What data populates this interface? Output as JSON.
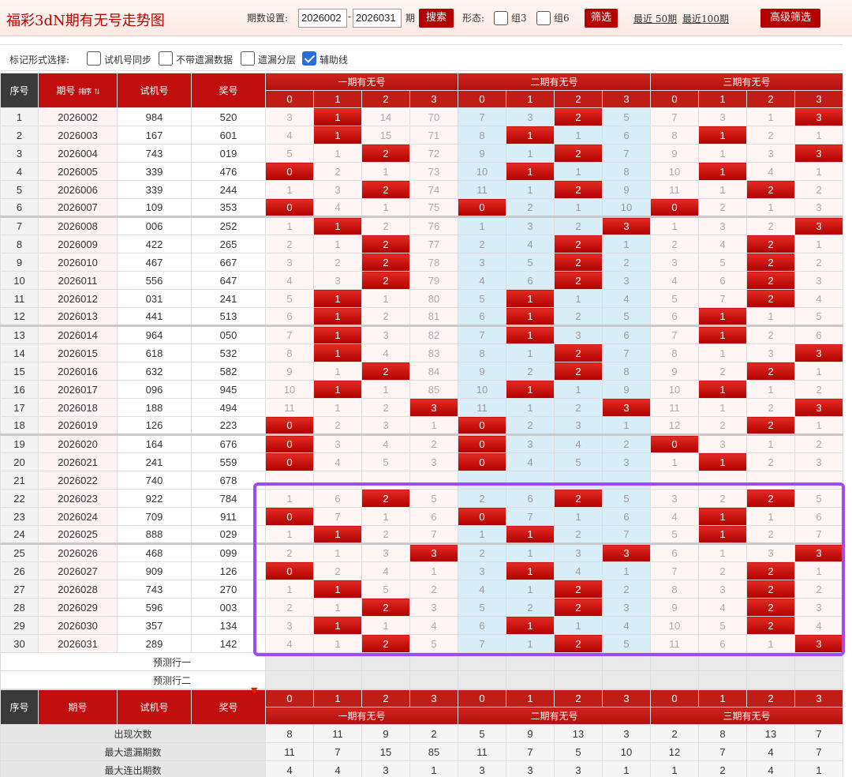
{
  "header": {
    "title": "福彩3dN期有无号走势图",
    "period_label": "期数设置:",
    "period_from": "2026002",
    "period_to": "2026031",
    "period_unit": "期",
    "search_btn": "搜索",
    "form_label": "形态:",
    "opt_group3": "组3",
    "opt_group6": "组6",
    "filter_btn": "筛选",
    "recent50": "最近 50期",
    "recent100": "最近100期",
    "advanced_btn": "高级筛选"
  },
  "mark_bar": {
    "label": "标记形式选择:",
    "opt1": "试机号同步",
    "opt2": "不带遗漏数据",
    "opt3": "遗漏分层",
    "opt4": "辅助线",
    "opt4_checked": true
  },
  "table_head": {
    "col_index": "序号",
    "col_period": "期号",
    "col_sort": "排序",
    "col_try": "试机号",
    "col_win": "奖号",
    "group1": "一期有无号",
    "group2": "二期有无号",
    "group3": "三期有无号",
    "digits": [
      "0",
      "1",
      "2",
      "3"
    ]
  },
  "rows": [
    {
      "i": "1",
      "p": "2026002",
      "t": "984",
      "w": "520",
      "c": [
        "3",
        "1",
        "14",
        "70",
        "7",
        "3",
        "2",
        "5",
        "7",
        "3",
        "1",
        "3"
      ],
      "h": [
        1,
        6,
        11
      ]
    },
    {
      "i": "2",
      "p": "2026003",
      "t": "167",
      "w": "601",
      "c": [
        "4",
        "1",
        "15",
        "71",
        "8",
        "1",
        "1",
        "6",
        "8",
        "1",
        "2",
        "1"
      ],
      "h": [
        1,
        5,
        9
      ]
    },
    {
      "i": "3",
      "p": "2026004",
      "t": "743",
      "w": "019",
      "c": [
        "5",
        "1",
        "2",
        "72",
        "9",
        "1",
        "2",
        "7",
        "9",
        "1",
        "3",
        "3"
      ],
      "h": [
        2,
        6,
        11
      ]
    },
    {
      "i": "4",
      "p": "2026005",
      "t": "339",
      "w": "476",
      "c": [
        "0",
        "2",
        "1",
        "73",
        "10",
        "1",
        "1",
        "8",
        "10",
        "1",
        "4",
        "1"
      ],
      "h": [
        0,
        5,
        9
      ]
    },
    {
      "i": "5",
      "p": "2026006",
      "t": "339",
      "w": "244",
      "c": [
        "1",
        "3",
        "2",
        "74",
        "11",
        "1",
        "2",
        "9",
        "11",
        "1",
        "2",
        "2"
      ],
      "h": [
        2,
        6,
        10
      ]
    },
    {
      "i": "6",
      "p": "2026007",
      "t": "109",
      "w": "353",
      "c": [
        "0",
        "4",
        "1",
        "75",
        "0",
        "2",
        "1",
        "10",
        "0",
        "2",
        "1",
        "3"
      ],
      "h": [
        0,
        4,
        8
      ]
    },
    {
      "i": "7",
      "p": "2026008",
      "t": "006",
      "w": "252",
      "c": [
        "1",
        "1",
        "2",
        "76",
        "1",
        "3",
        "2",
        "3",
        "1",
        "3",
        "2",
        "3"
      ],
      "h": [
        1,
        7,
        11
      ],
      "sep": true
    },
    {
      "i": "8",
      "p": "2026009",
      "t": "422",
      "w": "265",
      "c": [
        "2",
        "1",
        "2",
        "77",
        "2",
        "4",
        "2",
        "1",
        "2",
        "4",
        "2",
        "1"
      ],
      "h": [
        2,
        6,
        10
      ]
    },
    {
      "i": "9",
      "p": "2026010",
      "t": "467",
      "w": "667",
      "c": [
        "3",
        "2",
        "2",
        "78",
        "3",
        "5",
        "2",
        "2",
        "3",
        "5",
        "2",
        "2"
      ],
      "h": [
        2,
        6,
        10
      ]
    },
    {
      "i": "10",
      "p": "2026011",
      "t": "556",
      "w": "647",
      "c": [
        "4",
        "3",
        "2",
        "79",
        "4",
        "6",
        "2",
        "3",
        "4",
        "6",
        "2",
        "3"
      ],
      "h": [
        2,
        6,
        10
      ]
    },
    {
      "i": "11",
      "p": "2026012",
      "t": "031",
      "w": "241",
      "c": [
        "5",
        "1",
        "1",
        "80",
        "5",
        "1",
        "1",
        "4",
        "5",
        "7",
        "2",
        "4"
      ],
      "h": [
        1,
        5,
        10
      ]
    },
    {
      "i": "12",
      "p": "2026013",
      "t": "441",
      "w": "513",
      "c": [
        "6",
        "1",
        "2",
        "81",
        "6",
        "1",
        "2",
        "5",
        "6",
        "1",
        "1",
        "5"
      ],
      "h": [
        1,
        5,
        9
      ]
    },
    {
      "i": "13",
      "p": "2026014",
      "t": "964",
      "w": "050",
      "c": [
        "7",
        "1",
        "3",
        "82",
        "7",
        "1",
        "3",
        "6",
        "7",
        "1",
        "2",
        "6"
      ],
      "h": [
        1,
        5,
        9
      ],
      "sep": true
    },
    {
      "i": "14",
      "p": "2026015",
      "t": "618",
      "w": "532",
      "c": [
        "8",
        "1",
        "4",
        "83",
        "8",
        "1",
        "2",
        "7",
        "8",
        "1",
        "3",
        "3"
      ],
      "h": [
        1,
        6,
        11
      ]
    },
    {
      "i": "15",
      "p": "2026016",
      "t": "632",
      "w": "582",
      "c": [
        "9",
        "1",
        "2",
        "84",
        "9",
        "2",
        "2",
        "8",
        "9",
        "2",
        "2",
        "1"
      ],
      "h": [
        2,
        6,
        10
      ]
    },
    {
      "i": "16",
      "p": "2026017",
      "t": "096",
      "w": "945",
      "c": [
        "10",
        "1",
        "1",
        "85",
        "10",
        "1",
        "1",
        "9",
        "10",
        "1",
        "1",
        "2"
      ],
      "h": [
        1,
        5,
        9
      ]
    },
    {
      "i": "17",
      "p": "2026018",
      "t": "188",
      "w": "494",
      "c": [
        "11",
        "1",
        "2",
        "3",
        "11",
        "1",
        "2",
        "3",
        "11",
        "1",
        "2",
        "3"
      ],
      "h": [
        3,
        7,
        11
      ]
    },
    {
      "i": "18",
      "p": "2026019",
      "t": "126",
      "w": "223",
      "c": [
        "0",
        "2",
        "3",
        "1",
        "0",
        "2",
        "3",
        "1",
        "12",
        "2",
        "2",
        "1"
      ],
      "h": [
        0,
        4,
        10
      ]
    },
    {
      "i": "19",
      "p": "2026020",
      "t": "164",
      "w": "676",
      "c": [
        "0",
        "3",
        "4",
        "2",
        "0",
        "3",
        "4",
        "2",
        "0",
        "3",
        "1",
        "2"
      ],
      "h": [
        0,
        4,
        8
      ],
      "sep": true
    },
    {
      "i": "20",
      "p": "2026021",
      "t": "241",
      "w": "559",
      "c": [
        "0",
        "4",
        "5",
        "3",
        "0",
        "4",
        "5",
        "3",
        "1",
        "1",
        "2",
        "3"
      ],
      "h": [
        0,
        4,
        9
      ]
    },
    {
      "i": "21",
      "p": "2026022",
      "t": "740",
      "w": "678",
      "c": [
        "",
        "",
        "",
        "",
        "",
        "",
        "",
        "",
        "",
        "",
        "",
        ""
      ],
      "h": []
    },
    {
      "i": "22",
      "p": "2026023",
      "t": "922",
      "w": "784",
      "c": [
        "1",
        "6",
        "2",
        "5",
        "2",
        "6",
        "2",
        "5",
        "3",
        "2",
        "2",
        "5"
      ],
      "h": [
        2,
        6,
        10
      ]
    },
    {
      "i": "23",
      "p": "2026024",
      "t": "709",
      "w": "911",
      "c": [
        "0",
        "7",
        "1",
        "6",
        "0",
        "7",
        "1",
        "6",
        "4",
        "1",
        "1",
        "6"
      ],
      "h": [
        0,
        4,
        9
      ]
    },
    {
      "i": "24",
      "p": "2026025",
      "t": "888",
      "w": "029",
      "c": [
        "1",
        "1",
        "2",
        "7",
        "1",
        "1",
        "2",
        "7",
        "5",
        "1",
        "2",
        "7"
      ],
      "h": [
        1,
        5,
        9
      ]
    },
    {
      "i": "25",
      "p": "2026026",
      "t": "468",
      "w": "099",
      "c": [
        "2",
        "1",
        "3",
        "3",
        "2",
        "1",
        "3",
        "3",
        "6",
        "1",
        "3",
        "3"
      ],
      "h": [
        3,
        7,
        11
      ],
      "sep": true
    },
    {
      "i": "26",
      "p": "2026027",
      "t": "909",
      "w": "126",
      "c": [
        "0",
        "2",
        "4",
        "1",
        "3",
        "1",
        "4",
        "1",
        "7",
        "2",
        "2",
        "1"
      ],
      "h": [
        0,
        5,
        10
      ]
    },
    {
      "i": "27",
      "p": "2026028",
      "t": "743",
      "w": "270",
      "c": [
        "1",
        "1",
        "5",
        "2",
        "4",
        "1",
        "2",
        "2",
        "8",
        "3",
        "2",
        "2"
      ],
      "h": [
        1,
        6,
        10
      ]
    },
    {
      "i": "28",
      "p": "2026029",
      "t": "596",
      "w": "003",
      "c": [
        "2",
        "1",
        "2",
        "3",
        "5",
        "2",
        "2",
        "3",
        "9",
        "4",
        "2",
        "3"
      ],
      "h": [
        2,
        6,
        10
      ]
    },
    {
      "i": "29",
      "p": "2026030",
      "t": "357",
      "w": "134",
      "c": [
        "3",
        "1",
        "1",
        "4",
        "6",
        "1",
        "1",
        "4",
        "10",
        "5",
        "2",
        "4"
      ],
      "h": [
        1,
        5,
        10
      ]
    },
    {
      "i": "30",
      "p": "2026031",
      "t": "289",
      "w": "142",
      "c": [
        "4",
        "1",
        "2",
        "5",
        "7",
        "1",
        "2",
        "5",
        "11",
        "6",
        "1",
        "3"
      ],
      "h": [
        2,
        6,
        11
      ]
    }
  ],
  "predict": {
    "row1": "预测行一",
    "row2": "预测行二"
  },
  "bottom_head": {
    "col_index": "序号",
    "col_period": "期号",
    "col_try": "试机号",
    "col_win": "奖号",
    "group1": "一期有无号",
    "group2": "二期有无号",
    "group3": "三期有无号"
  },
  "stats": [
    {
      "label": "出现次数",
      "values": [
        "8",
        "11",
        "9",
        "2",
        "5",
        "9",
        "13",
        "3",
        "2",
        "8",
        "13",
        "7"
      ]
    },
    {
      "label": "最大遗漏期数",
      "values": [
        "11",
        "7",
        "15",
        "85",
        "11",
        "7",
        "5",
        "10",
        "12",
        "7",
        "4",
        "7"
      ]
    },
    {
      "label": "最大连出期数",
      "values": [
        "4",
        "4",
        "3",
        "1",
        "3",
        "3",
        "3",
        "1",
        "1",
        "2",
        "4",
        "1"
      ]
    }
  ]
}
